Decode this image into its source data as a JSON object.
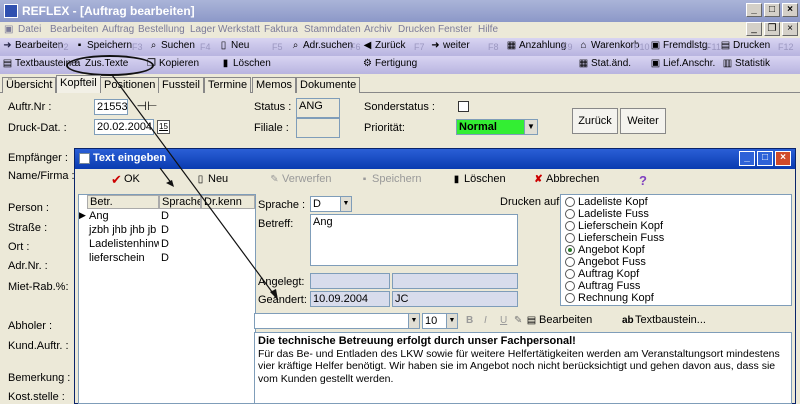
{
  "window": {
    "title": "REFLEX - [Auftrag bearbeiten]"
  },
  "menu": [
    "Datei",
    "Bearbeiten",
    "Auftrag",
    "Bestellung",
    "Lager",
    "Werkstatt",
    "Faktura",
    "Stammdaten",
    "Archiv",
    "Drucken",
    "Fenster",
    "Hilfe"
  ],
  "toolbar1": [
    {
      "label": "Bearbeiten",
      "key": "F2"
    },
    {
      "label": "Speichern",
      "key": "F3"
    },
    {
      "label": "Suchen",
      "key": "F4"
    },
    {
      "label": "Neu",
      "key": "F5"
    },
    {
      "label": "Adr.suchen",
      "key": "F6"
    },
    {
      "label": "Zurück",
      "key": "F7"
    },
    {
      "label": "weiter",
      "key": "F8"
    },
    {
      "label": "Anzahlung",
      "key": "F9"
    },
    {
      "label": "Warenkorb",
      "key": "F10"
    },
    {
      "label": "Fremdlstg.",
      "key": "F11"
    },
    {
      "label": "Drucken",
      "key": "F12"
    }
  ],
  "toolbar2": [
    "Textbausteine",
    "Zus.Texte",
    "Kopieren",
    "Löschen",
    "Fertigung",
    "Stat.änd.",
    "Lief.Anschr.",
    "Statistik"
  ],
  "tabs": [
    "Übersicht",
    "Kopfteil",
    "Positionen",
    "Fussteil",
    "Termine",
    "Memos",
    "Dokumente"
  ],
  "form": {
    "auftr_nr_label": "Auftr.Nr :",
    "auftr_nr": "21553",
    "druck_dat_label": "Druck-Dat. :",
    "druck_dat": "20.02.2004",
    "cal_icon_text": "15",
    "status_label": "Status :",
    "status": "ANG",
    "filiale_label": "Filiale :",
    "filiale": "",
    "sonderstatus_label": "Sonderstatus :",
    "prioritaet_label": "Priorität:",
    "prioritaet": "Normal",
    "zurueck": "Zurück",
    "weiter": "Weiter",
    "left_labels": [
      "Empfänger :",
      "Name/Firma :",
      "Person :",
      "Straße :",
      "Ort :",
      "Adr.Nr. :",
      "Miet-Rab.%:",
      "Abholer :",
      "Kund.Auftr. :",
      "Bemerkung :",
      "Kost.stelle :"
    ]
  },
  "dialog": {
    "title": "Text eingeben",
    "buttons": [
      "OK",
      "Neu",
      "Verwerfen",
      "Speichern",
      "Löschen",
      "Abbrechen",
      "?"
    ],
    "grid_headers": [
      "Betr.",
      "Sprache",
      "Dr.kenn"
    ],
    "rows": [
      {
        "betr": "Ang",
        "sprache": "D"
      },
      {
        "betr": "jzbh jhb jhb jb",
        "sprache": "D"
      },
      {
        "betr": "Ladelistenhinw",
        "sprache": "D"
      },
      {
        "betr": "lieferschein",
        "sprache": "D"
      }
    ],
    "sprache_label": "Sprache :",
    "sprache": "D",
    "betreff_label": "Betreff:",
    "betreff": "Ang",
    "angelegt_label": "Angelegt:",
    "angelegt": "",
    "angelegt_by": "",
    "geaendert_label": "Geändert:",
    "geaendert": "10.09.2004",
    "geaendert_by": "JC",
    "drucken_auf_label": "Drucken auf:",
    "drucken_auf": [
      {
        "label": "Ladeliste Kopf",
        "on": false
      },
      {
        "label": "Ladeliste Fuss",
        "on": false
      },
      {
        "label": "Lieferschein Kopf",
        "on": false
      },
      {
        "label": "Lieferschein Fuss",
        "on": false
      },
      {
        "label": "Angebot Kopf",
        "on": true
      },
      {
        "label": "Angebot Fuss",
        "on": false
      },
      {
        "label": "Auftrag Kopf",
        "on": false
      },
      {
        "label": "Auftrag Fuss",
        "on": false
      },
      {
        "label": "Rechnung Kopf",
        "on": false
      }
    ],
    "font_size": "10",
    "bearbeiten": "Bearbeiten",
    "textbaustein": "Textbaustein...",
    "text_heading": "Die technische Betreuung erfolgt durch unser Fachpersonal!",
    "text_body": "Für das Be- und Entladen des LKW sowie für weitere Helfertätigkeiten werden am Veranstaltungsort mindestens vier kräftige Helfer benötigt. Wir haben sie im Angebot noch nicht berücksichtigt und gehen davon aus, dass sie vom Kunden gestellt werden."
  },
  "colors": {
    "priority_bg": "#33ee33",
    "dialog_title": "#0a3bb0",
    "toolbar_bg": "#c8c4ec"
  }
}
